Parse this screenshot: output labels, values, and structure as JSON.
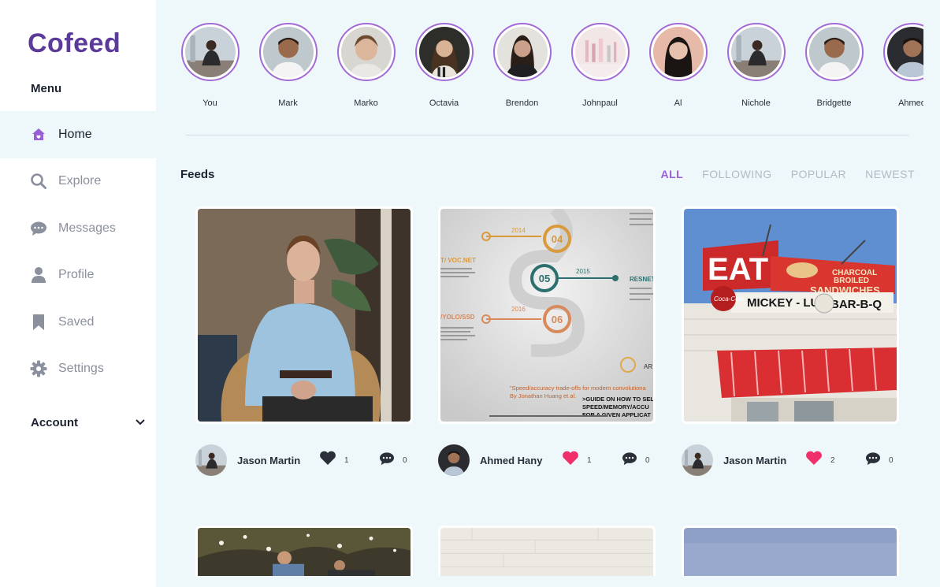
{
  "app": {
    "logo": "Cofeed"
  },
  "sidebar": {
    "menu_title": "Menu",
    "items": [
      {
        "label": "Home",
        "icon": "home-icon",
        "active": true
      },
      {
        "label": "Explore",
        "icon": "search-icon",
        "active": false
      },
      {
        "label": "Messages",
        "icon": "chat-bubble-icon",
        "active": false
      },
      {
        "label": "Profile",
        "icon": "user-icon",
        "active": false
      },
      {
        "label": "Saved",
        "icon": "bookmark-icon",
        "active": false
      },
      {
        "label": "Settings",
        "icon": "gear-icon",
        "active": false
      }
    ],
    "account_label": "Account"
  },
  "stories": [
    {
      "name": "You"
    },
    {
      "name": "Mark"
    },
    {
      "name": "Marko"
    },
    {
      "name": "Octavia"
    },
    {
      "name": "Brendon"
    },
    {
      "name": "Johnpaul"
    },
    {
      "name": "Al"
    },
    {
      "name": "Nichole"
    },
    {
      "name": "Bridgette"
    },
    {
      "name": "Ahmed"
    }
  ],
  "feeds": {
    "title": "Feeds",
    "filters": [
      {
        "label": "ALL",
        "active": true
      },
      {
        "label": "FOLLOWING",
        "active": false
      },
      {
        "label": "POPULAR",
        "active": false
      },
      {
        "label": "NEWEST",
        "active": false
      }
    ],
    "posts": [
      {
        "author": "Jason Martin",
        "likes": "1",
        "comments": "0",
        "liked": false
      },
      {
        "author": "Ahmed Hany",
        "likes": "1",
        "comments": "0",
        "liked": true
      },
      {
        "author": "Jason Martin",
        "likes": "2",
        "comments": "0",
        "liked": true
      }
    ],
    "infographic": {
      "left_labels": [
        "T/ VOC.NET",
        "/YOLO/SSD"
      ],
      "years": [
        "2014",
        "2015",
        "2016"
      ],
      "steps": [
        "04",
        "05",
        "06"
      ],
      "right_label": "RESNET",
      "footer_line1": "\"Speed/accuracy trade-offs for modern convolutiona",
      "footer_line2": "By Jonathan Huang et al.",
      "footer_guide": ">GUIDE ON HOW TO SELE",
      "footer_guide2": "SPEED/MEMORY/ACCU",
      "footer_guide3": "FOR A GIVEN APPLICAT",
      "brand_partial": "AR"
    },
    "sign": {
      "eat": "EAT",
      "charcoal": "CHARCOAL",
      "broiled": "BROILED",
      "sandwiches": "SANDWICHES",
      "mickey": "MICKEY - LU",
      "bbq": "BAR-B-Q",
      "cola": "Coca-Cola"
    }
  },
  "colors": {
    "brand": "#5b3a9a",
    "accent": "#9a5fd3",
    "story_ring": "#a36bd6",
    "like_active": "#f0306b",
    "background": "#eef8fa"
  }
}
